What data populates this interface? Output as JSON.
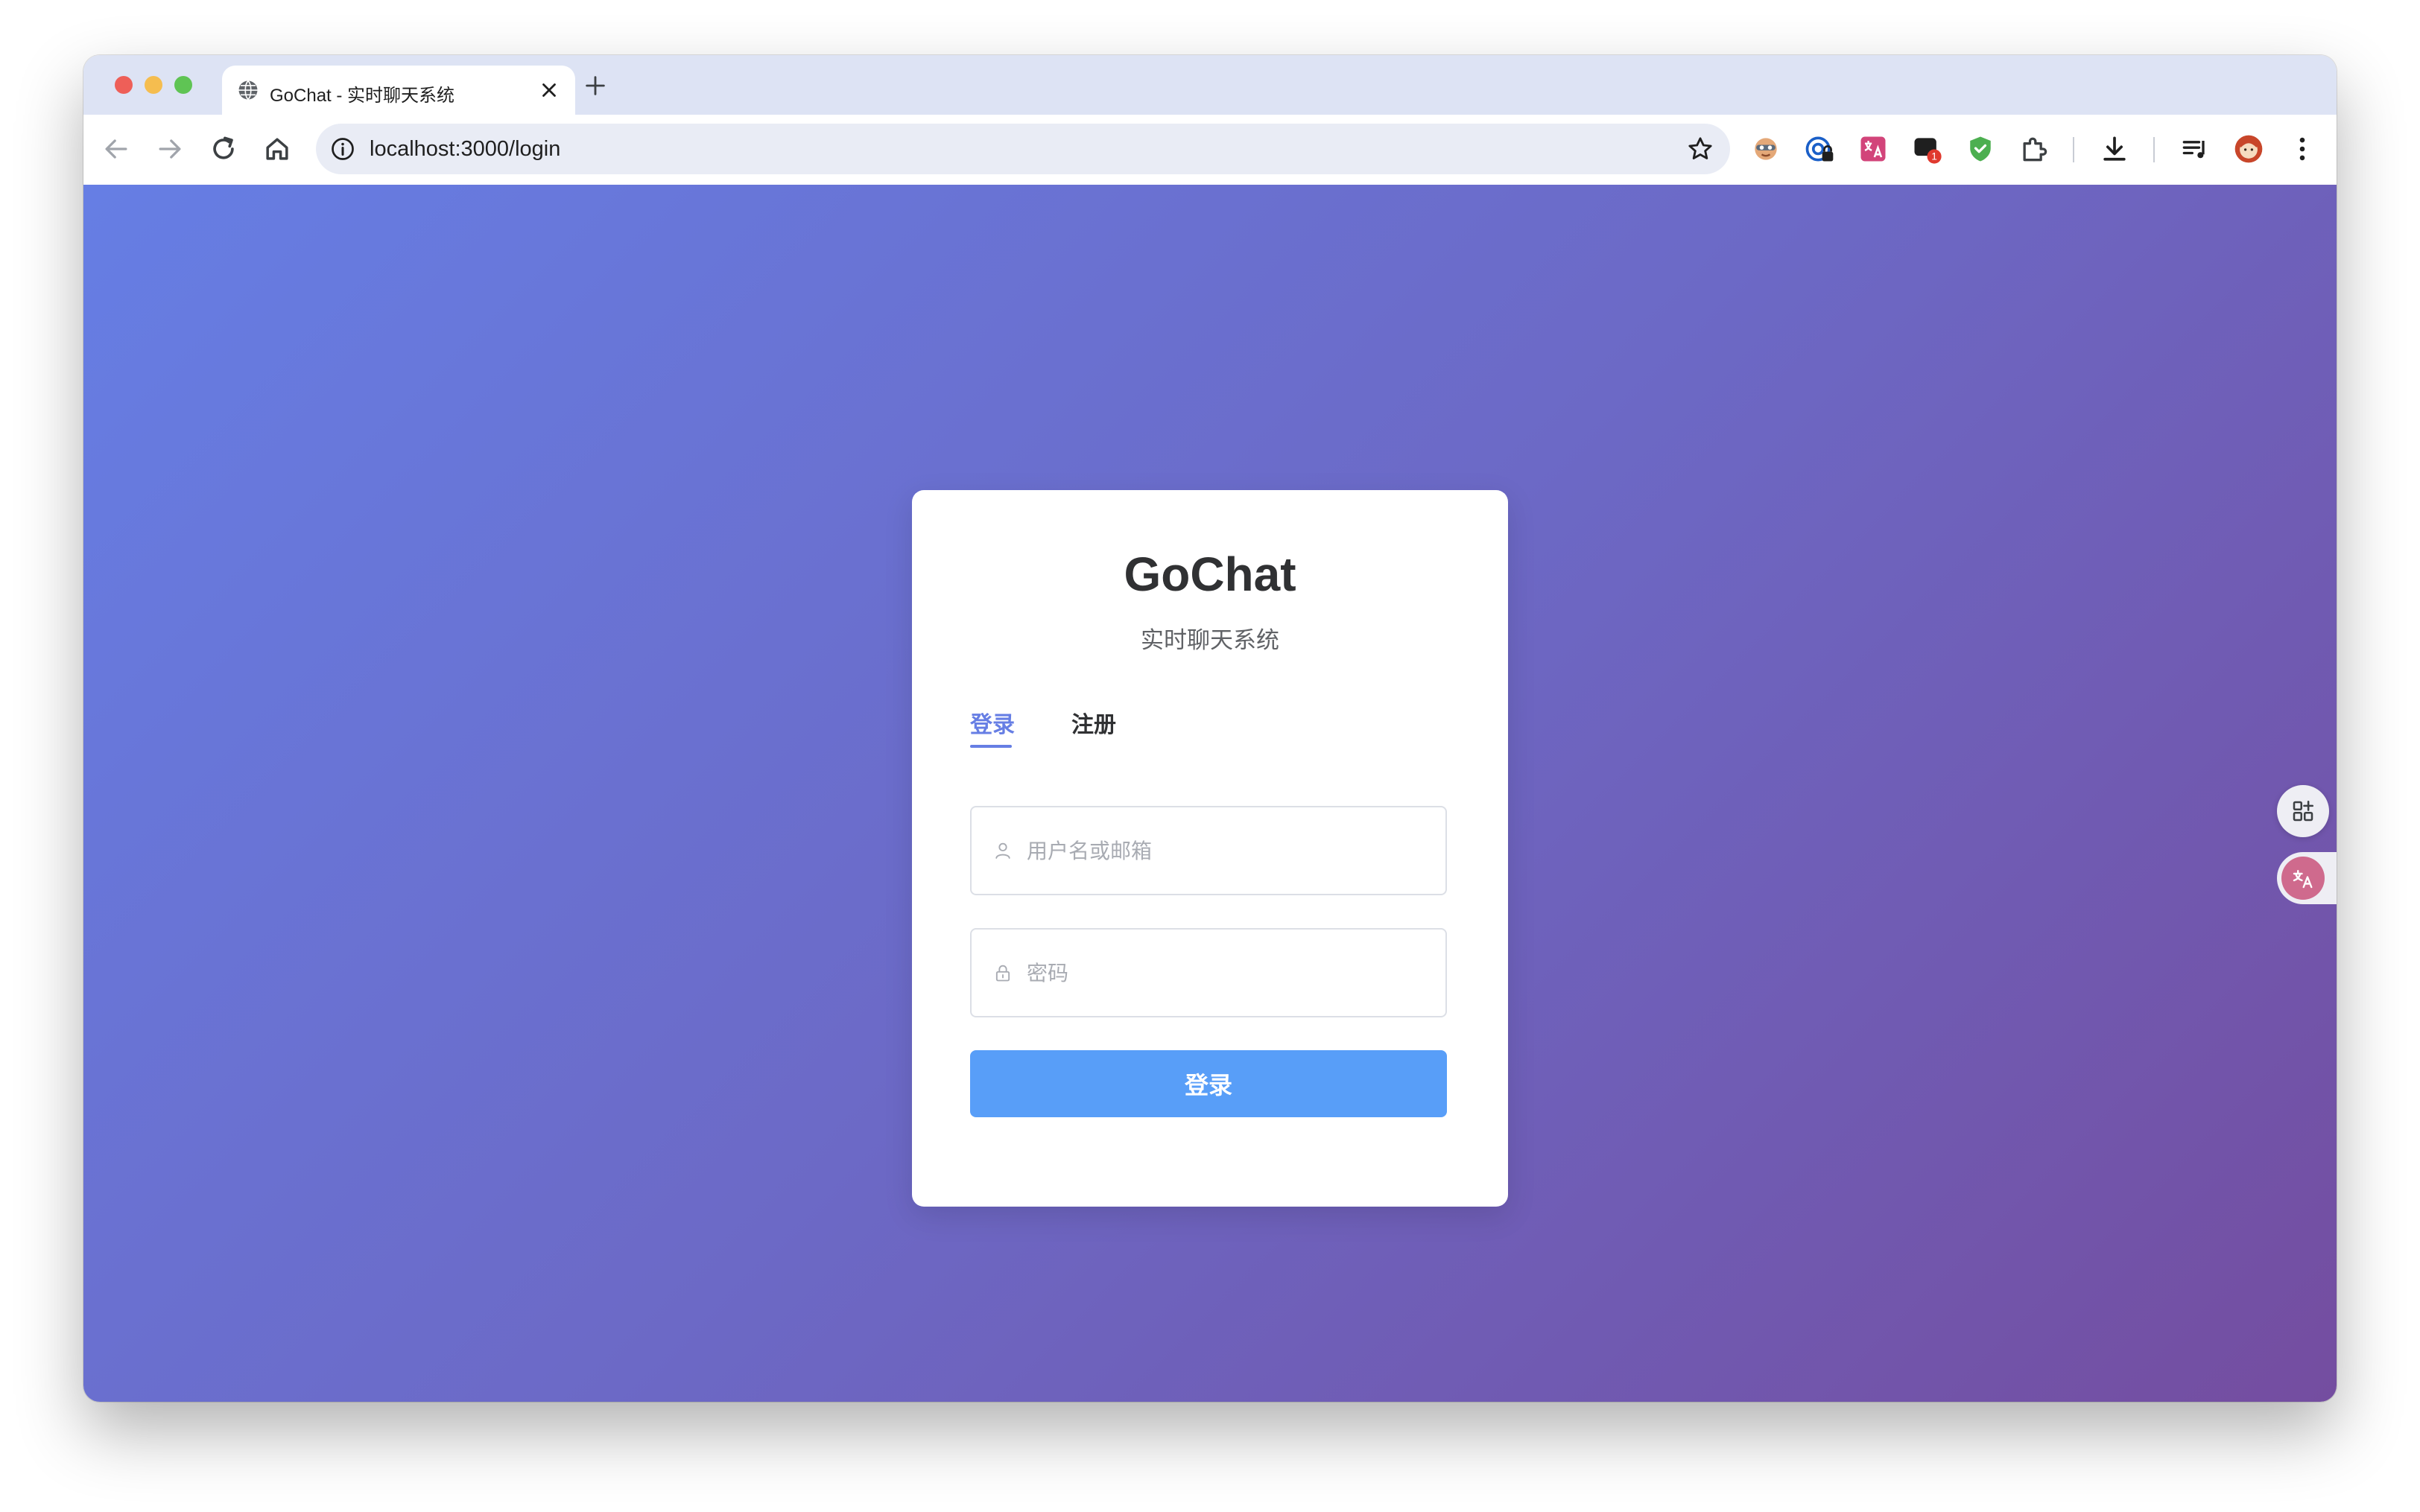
{
  "browser": {
    "tab_title": "GoChat - 实时聊天系统",
    "url": "localhost:3000/login",
    "extension_badge": "1"
  },
  "login_card": {
    "title": "GoChat",
    "subtitle": "实时聊天系统",
    "tabs": [
      {
        "label": "登录",
        "active": true
      },
      {
        "label": "注册",
        "active": false
      }
    ],
    "username_placeholder": "用户名或邮箱",
    "password_placeholder": "密码",
    "submit_label": "登录"
  },
  "colors": {
    "accent": "#667ee4",
    "button": "#589ef8",
    "gradient_start": "#667ee4",
    "gradient_end": "#744da0"
  }
}
